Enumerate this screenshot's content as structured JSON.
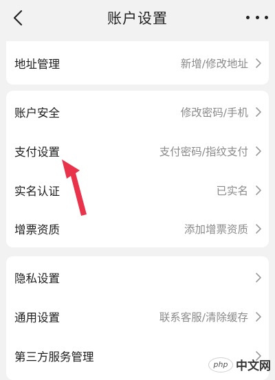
{
  "header": {
    "title": "账户设置"
  },
  "sections": [
    {
      "rows": [
        {
          "label": "地址管理",
          "value": "新增/修改地址"
        }
      ]
    },
    {
      "rows": [
        {
          "label": "账户安全",
          "value": "修改密码/手机"
        },
        {
          "label": "支付设置",
          "value": "支付密码/指纹支付"
        },
        {
          "label": "实名认证",
          "value": "已实名"
        },
        {
          "label": "增票资质",
          "value": "添加增票资质"
        }
      ]
    },
    {
      "rows": [
        {
          "label": "隐私设置",
          "value": ""
        },
        {
          "label": "通用设置",
          "value": "联系客服/清除缓存"
        },
        {
          "label": "第三方服务管理",
          "value": ""
        }
      ]
    }
  ],
  "watermark": {
    "logo": "php",
    "site": "中文网"
  },
  "colors": {
    "background": "#f2f2f2",
    "card": "#ffffff",
    "value_text": "#8a8a8a",
    "annotation_arrow": "#e8334a"
  }
}
